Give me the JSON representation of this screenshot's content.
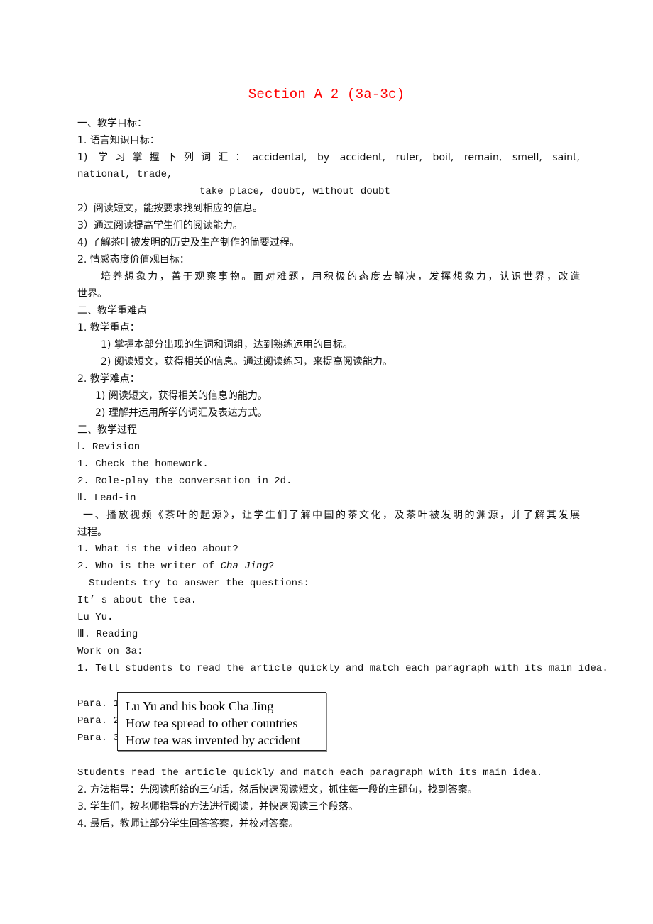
{
  "title": "Section A 2 (3a-3c)",
  "objectives": {
    "heading": "一、教学目标：",
    "language_heading": "1. 语言知识目标：",
    "vocab_line1": "1) 学习掌握下列词汇：accidental, by accident, ruler, boil, remain, smell, saint,",
    "vocab_line2": "national, trade,",
    "vocab_line3": "take place, doubt, without doubt",
    "item2": "2）阅读短文，能按要求找到相应的信息。",
    "item3": "3）通过阅读提高学生们的阅读能力。",
    "item4": "4) 了解茶叶被发明的历史及生产制作的简要过程。",
    "emotion_heading": "2. 情感态度价值观目标：",
    "emotion_line1": "培养想象力，善于观察事物。面对难题，用积极的态度去解决，发挥想象力，认识世界，改造",
    "emotion_line2": "世界。"
  },
  "key_points": {
    "heading": "二、教学重难点",
    "focus_heading": "1. 教学重点：",
    "focus_1": "1) 掌握本部分出现的生词和词组，达到熟练运用的目标。",
    "focus_2": "2) 阅读短文，获得相关的信息。通过阅读练习，来提高阅读能力。",
    "difficulty_heading": "2. 教学难点：",
    "difficulty_1": "1) 阅读短文，获得相关的信息的能力。",
    "difficulty_2": "2) 理解并运用所学的词汇及表达方式。"
  },
  "process": {
    "heading": "三、教学过程",
    "revision_heading": "Ⅰ. Revision",
    "revision_1": "1. Check the homework.",
    "revision_2": "2. Role-play the conversation in 2d.",
    "leadin_heading": "Ⅱ. Lead-in",
    "leadin_line1": "一、播放视频《茶叶的起源》，让学生们了解中国的茶文化，及茶叶被发明的渊源，并了解其发展",
    "leadin_line2": "过程。",
    "question_1": "1. What is the video about?",
    "question_2_prefix": "2. Who is the writer of ",
    "question_2_italic": "Cha Jing",
    "question_2_suffix": "?",
    "students_try": "Students try to answer the questions:",
    "answer_1": "It’ s about the tea.",
    "answer_2": "Lu Yu.",
    "reading_heading": "Ⅲ. Reading",
    "work_on": "Work on 3a:",
    "step_1": "1.  Tell students to read the article quickly and match each paragraph with its main idea.",
    "para_labels": [
      "Para. 1",
      "Para. 2",
      "Para. 3"
    ],
    "main_ideas": [
      "Lu Yu and his book Cha Jing",
      "How tea spread to other countries",
      "How tea was invented by accident"
    ],
    "students_read": "Students read the article quickly and match each paragraph with its main idea.",
    "step_2": "2. 方法指导：先阅读所给的三句话，然后快速阅读短文，抓住每一段的主题句，找到答案。",
    "step_3": "3. 学生们，按老师指导的方法进行阅读，并快速阅读三个段落。",
    "step_4": "4. 最后，教师让部分学生回答答案，并校对答案。"
  },
  "colors": {
    "title": "#ff0000",
    "text": "#111111"
  }
}
